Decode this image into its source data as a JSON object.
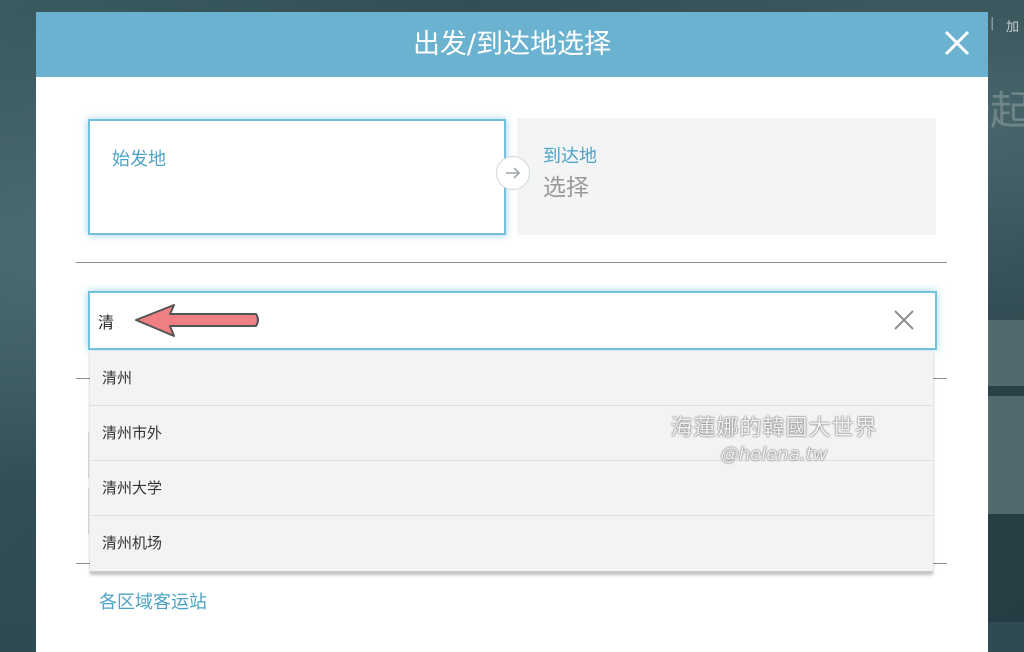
{
  "background": {
    "top_right_text": "加",
    "big_char": "一起"
  },
  "modal": {
    "title": "出发/到达地选择",
    "close_icon": "close-icon"
  },
  "origin": {
    "label": "始发地",
    "value": ""
  },
  "destination": {
    "label": "到达地",
    "value": "选择"
  },
  "search": {
    "value": "清",
    "placeholder": ""
  },
  "suggestions": [
    {
      "label": "清州"
    },
    {
      "label": "清州市外"
    },
    {
      "label": "清州大学"
    },
    {
      "label": "清州机场"
    }
  ],
  "regions_link": "各区域客运站",
  "watermark": {
    "line1": "海蓮娜的韓國大世界",
    "line2": "@helena.tw"
  },
  "colors": {
    "header": "#6ab2cf",
    "accent": "#4ea3c4",
    "focus_border": "#74c0dc",
    "annotation": "#ef7f82"
  }
}
